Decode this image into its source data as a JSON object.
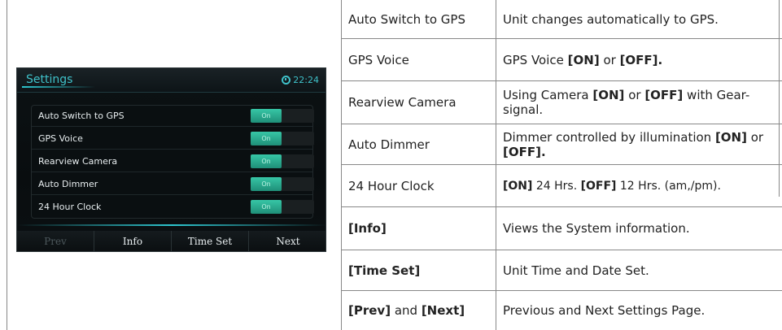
{
  "device": {
    "title": "Settings",
    "clock": "22:24",
    "items": [
      {
        "label": "Auto Switch to GPS",
        "state": "On"
      },
      {
        "label": "GPS Voice",
        "state": "On"
      },
      {
        "label": "Rearview Camera",
        "state": "On"
      },
      {
        "label": "Auto Dimmer",
        "state": "On"
      },
      {
        "label": "24 Hour Clock",
        "state": "On"
      }
    ],
    "footer": [
      "Prev",
      "Info",
      "Time Set",
      "Next"
    ],
    "accent": "#3fc1c9",
    "toggle_color": "#2ea98c"
  },
  "table": {
    "rows": [
      {
        "name": "Auto Switch to GPS",
        "desc": "Unit changes automatically to GPS."
      },
      {
        "name": "GPS Voice",
        "desc_parts": [
          "GPS Voice ",
          "[ON]",
          " or ",
          "[OFF]."
        ]
      },
      {
        "name": "Rearview Camera",
        "desc_parts": [
          "Using Camera ",
          "[ON]",
          " or ",
          "[OFF]",
          " with Gear-signal."
        ]
      },
      {
        "name": "Auto Dimmer",
        "desc_parts": [
          "Dimmer controlled by illumination ",
          "[ON]",
          " or ",
          "[OFF]."
        ]
      },
      {
        "name": "24 Hour Clock",
        "desc_parts": [
          "[ON]",
          " 24 Hrs. ",
          "[OFF]",
          " 12 Hrs. (am,/pm)."
        ]
      },
      {
        "name": "[Info]",
        "desc": "Views the System information."
      },
      {
        "name": "[Time Set]",
        "desc": "Unit Time and Date Set."
      },
      {
        "name_parts": [
          "[Prev]",
          " and ",
          "[Next]"
        ],
        "desc": "Previous and Next Settings Page."
      }
    ]
  }
}
